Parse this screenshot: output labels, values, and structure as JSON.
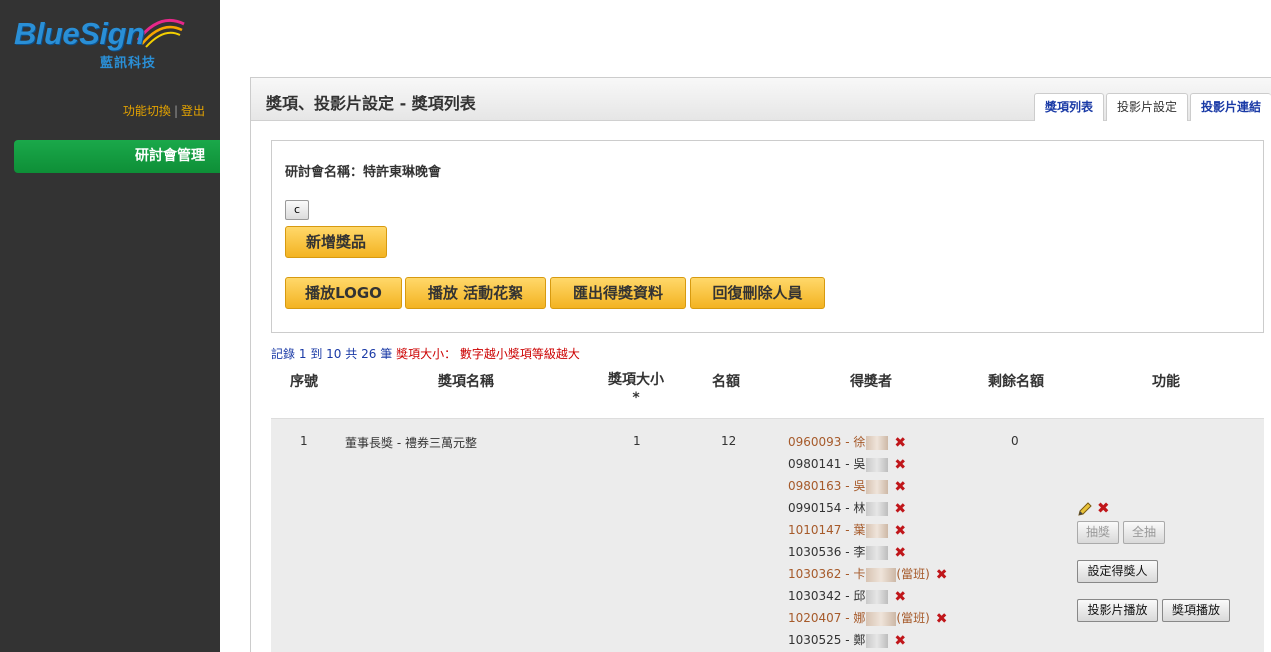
{
  "sidebar": {
    "logo_text": "BlueSign",
    "logo_sub": "藍訊科技",
    "link_switch": "功能切換",
    "link_sep": "|",
    "link_logout": "登出",
    "nav_active": "研討會管理"
  },
  "header": {
    "title": "獎項、投影片設定 - 獎項列表",
    "tabs": [
      "獎項列表",
      "投影片設定",
      "投影片連結"
    ]
  },
  "info": {
    "conference_name": "研討會名稱：特許東琳晚會",
    "small_button": "c",
    "add_prize": "新增獎品",
    "buttons": [
      "播放LOGO",
      "播放 活動花絮",
      "匯出得獎資料",
      "回復刪除人員"
    ]
  },
  "summary": {
    "record": "記錄",
    "from": "1",
    "to_label": "到",
    "to": "10",
    "total_label": "共",
    "total": "26",
    "unit": "筆",
    "note": "獎項大小： 數字越小獎項等級越大"
  },
  "table": {
    "headers": [
      "序號",
      "獎項名稱",
      "獎項大小*",
      "名額",
      "得獎者",
      "剩餘名額",
      "功能"
    ],
    "rows": [
      {
        "seq": "1",
        "name": "董事長獎 - 禮券三萬元整",
        "size": "1",
        "quota": "12",
        "remaining": "0",
        "winners": [
          {
            "id": "0960093 - 徐",
            "tag": ""
          },
          {
            "id": "0980141 - 吳",
            "tag": ""
          },
          {
            "id": "0980163 - 吳",
            "tag": ""
          },
          {
            "id": "0990154 - 林",
            "tag": ""
          },
          {
            "id": "1010147 - 葉",
            "tag": ""
          },
          {
            "id": "1030536 - 李",
            "tag": ""
          },
          {
            "id": "1030362 - 卡",
            "tag": "(當班)"
          },
          {
            "id": "1030342 - 邱",
            "tag": ""
          },
          {
            "id": "1020407 - 娜",
            "tag": "(當班)"
          },
          {
            "id": "1030525 - 鄭",
            "tag": ""
          }
        ],
        "actions": {
          "draw": "抽獎",
          "draw_all": "全抽",
          "set_winner": "設定得獎人",
          "slide_play": "投影片播放",
          "prize_play": "獎項播放"
        }
      }
    ]
  },
  "colors": {
    "sidebar_bg": "#333333",
    "nav_green": "#14a040",
    "gold": "#f3b321",
    "link_blue": "#1a3aa6",
    "delete_red": "#c0161a"
  }
}
